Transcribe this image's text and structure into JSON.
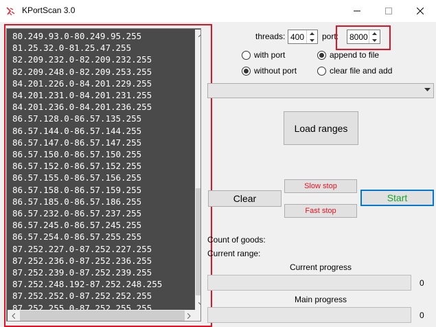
{
  "window": {
    "title": "KPortScan 3.0",
    "controls": [
      "minimize",
      "maximize",
      "close"
    ]
  },
  "ranges": {
    "lines": [
      "80.249.93.0-80.249.95.255",
      "81.25.32.0-81.25.47.255",
      "82.209.232.0-82.209.232.255",
      "82.209.248.0-82.209.253.255",
      "84.201.226.0-84.201.229.255",
      "84.201.231.0-84.201.231.255",
      "84.201.236.0-84.201.236.255",
      "86.57.128.0-86.57.135.255",
      "86.57.144.0-86.57.144.255",
      "86.57.147.0-86.57.147.255",
      "86.57.150.0-86.57.150.255",
      "86.57.152.0-86.57.152.255",
      "86.57.155.0-86.57.156.255",
      "86.57.158.0-86.57.159.255",
      "86.57.185.0-86.57.186.255",
      "86.57.232.0-86.57.237.255",
      "86.57.245.0-86.57.245.255",
      "86.57.254.0-86.57.255.255",
      "87.252.227.0-87.252.227.255",
      "87.252.236.0-87.252.236.255",
      "87.252.239.0-87.252.239.255",
      "87.252.248.192-87.252.248.255",
      "87.252.252.0-87.252.252.255",
      "87.252.255.0-87.252.255.255"
    ]
  },
  "settings": {
    "threads_label": "threads:",
    "threads_value": "400",
    "port_label": "port:",
    "port_value": "8000",
    "with_port_label": "with port",
    "without_port_label": "without port",
    "append_label": "append to file",
    "clear_file_label": "clear file and add",
    "port_mode_selected": "without port",
    "file_mode_selected": "append to file"
  },
  "combo": {
    "value": ""
  },
  "buttons": {
    "load_ranges": "Load ranges",
    "slow_stop": "Slow stop",
    "fast_stop": "Fast stop",
    "clear": "Clear",
    "start": "Start"
  },
  "status": {
    "count_label": "Count of goods:",
    "range_label": "Current range:"
  },
  "progress": {
    "current_label": "Current progress",
    "current_value": "0",
    "current_fraction": 0,
    "main_label": "Main progress",
    "main_value": "0",
    "main_fraction": 0
  },
  "colors": {
    "highlight": "#e81123",
    "stop_text": "#e81123",
    "start_text": "#17a32e",
    "focus_border": "#0078d7",
    "list_bg": "#4a4a4a"
  }
}
